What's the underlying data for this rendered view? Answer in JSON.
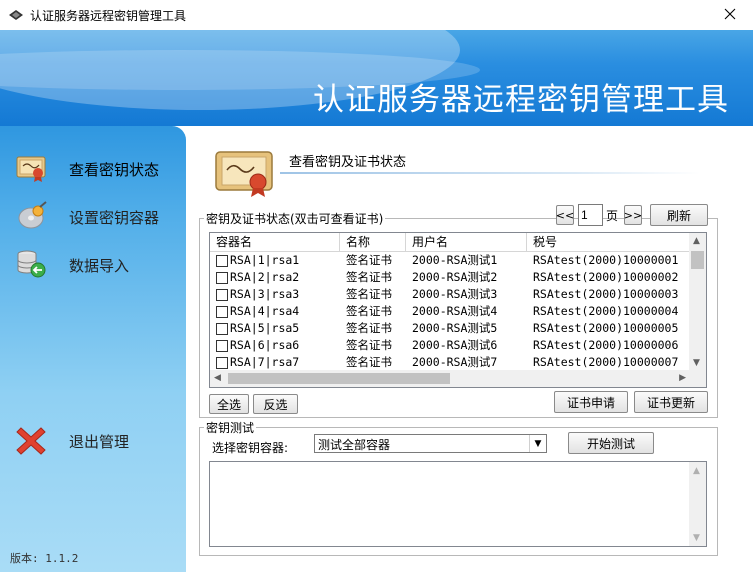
{
  "window": {
    "title": "认证服务器远程密钥管理工具"
  },
  "banner": {
    "title": "认证服务器远程密钥管理工具"
  },
  "sidebar": {
    "items": [
      {
        "label": "查看密钥状态",
        "icon": "certificate-icon",
        "active": true
      },
      {
        "label": "设置密钥容器",
        "icon": "disc-key-icon",
        "active": false
      },
      {
        "label": "数据导入",
        "icon": "database-import-icon",
        "active": false
      },
      {
        "label": "退出管理",
        "icon": "red-x-icon",
        "active": false
      }
    ],
    "version": "版本: 1.1.2"
  },
  "header": {
    "title": "查看密钥及证书状态"
  },
  "cert_group": {
    "legend": "密钥及证书状态(双击可查看证书)",
    "pager": {
      "prev": "<<",
      "page": "1",
      "page_unit": "页",
      "next": ">>",
      "refresh": "刷新"
    },
    "columns": [
      "容器名",
      "名称",
      "用户名",
      "税号"
    ],
    "rows": [
      [
        "RSA|1|rsa1",
        "签名证书",
        "2000-RSA测试1",
        "RSAtest(2000)10000001"
      ],
      [
        "RSA|2|rsa2",
        "签名证书",
        "2000-RSA测试2",
        "RSAtest(2000)10000002"
      ],
      [
        "RSA|3|rsa3",
        "签名证书",
        "2000-RSA测试3",
        "RSAtest(2000)10000003"
      ],
      [
        "RSA|4|rsa4",
        "签名证书",
        "2000-RSA测试4",
        "RSAtest(2000)10000004"
      ],
      [
        "RSA|5|rsa5",
        "签名证书",
        "2000-RSA测试5",
        "RSAtest(2000)10000005"
      ],
      [
        "RSA|6|rsa6",
        "签名证书",
        "2000-RSA测试6",
        "RSAtest(2000)10000006"
      ],
      [
        "RSA|7|rsa7",
        "签名证书",
        "2000-RSA测试7",
        "RSAtest(2000)10000007"
      ]
    ],
    "select_all": "全选",
    "invert": "反选",
    "apply_cert": "证书申请",
    "update_cert": "证书更新"
  },
  "test_group": {
    "legend": "密钥测试",
    "select_label": "选择密钥容器:",
    "select_value": "测试全部容器",
    "start": "开始测试",
    "output": ""
  },
  "colors": {
    "banner": "#1f87dc",
    "sidebar": "#5eb5ea",
    "accent_red": "#d93a2b"
  }
}
